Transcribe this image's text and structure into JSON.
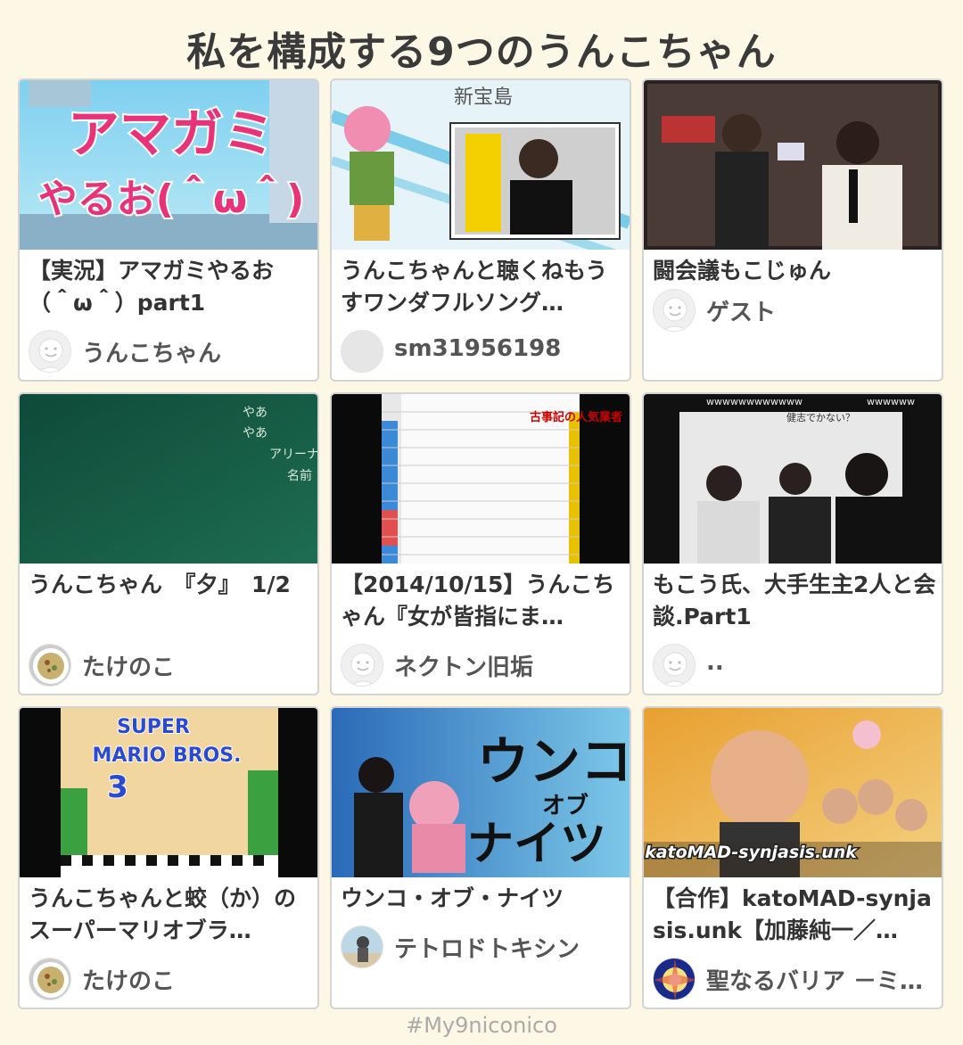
{
  "page": {
    "title": "私を構成する9つのうんこちゃん",
    "hashtag": "#My9niconico"
  },
  "videos": [
    {
      "title": "【実況】アマガミやるお（＾ω＾）part1",
      "owner": "うんこちゃん",
      "avatar": "default-face-icon",
      "thumb_text": [
        "アマガミ",
        "やるお(＾ω＾)"
      ]
    },
    {
      "title": "うんこちゃんと聴くねもうすワンダフルソング…",
      "owner": "sm31956198",
      "avatar": "blank-avatar",
      "thumb_text": [
        "新宝島"
      ]
    },
    {
      "title": "闘会議もこじゅん",
      "owner": "ゲスト",
      "avatar": "default-face-icon"
    },
    {
      "title": "うんこちゃん　『夕』　1/2",
      "owner": "たけのこ",
      "avatar": "food-photo-avatar",
      "thumb_text": [
        "やあ",
        "やあ",
        "アリーナ",
        "名前"
      ]
    },
    {
      "title": "【2014/10/15】うんこちゃん『女が皆指にま…",
      "owner": "ネクトン旧垢",
      "avatar": "default-face-icon",
      "thumb_text": [
        "古事記の人気業者"
      ]
    },
    {
      "title": "もこう氏、大手生主2人と会談.Part1",
      "owner": "..",
      "avatar": "default-face-icon",
      "thumb_text": [
        "wwwwwwwwwwww",
        "wwwwww",
        "健志でかない？"
      ]
    },
    {
      "title": "うんこちゃんと蛟（か）のスーパーマリオブラ…",
      "owner": "たけのこ",
      "avatar": "food-photo-avatar",
      "thumb_text": [
        "SUPER",
        "MARIO BROS.",
        "3"
      ]
    },
    {
      "title": "ウンコ・オブ・ナイツ",
      "owner": "テトロドトキシン",
      "avatar": "photo-avatar",
      "thumb_text": [
        "ウンコ",
        "オブ",
        "ナイツ"
      ]
    },
    {
      "title": "【合作】katoMAD-synjasis.unk【加藤純一／…",
      "owner": "聖なるバリア －ミ…",
      "avatar": "burst-avatar",
      "thumb_text": [
        "katoMAD-synjasis.unk"
      ]
    }
  ],
  "colors": {
    "background": "#fdf8e6",
    "card_border": "#d4d4d4",
    "amagami_pink": "#e8337a"
  }
}
